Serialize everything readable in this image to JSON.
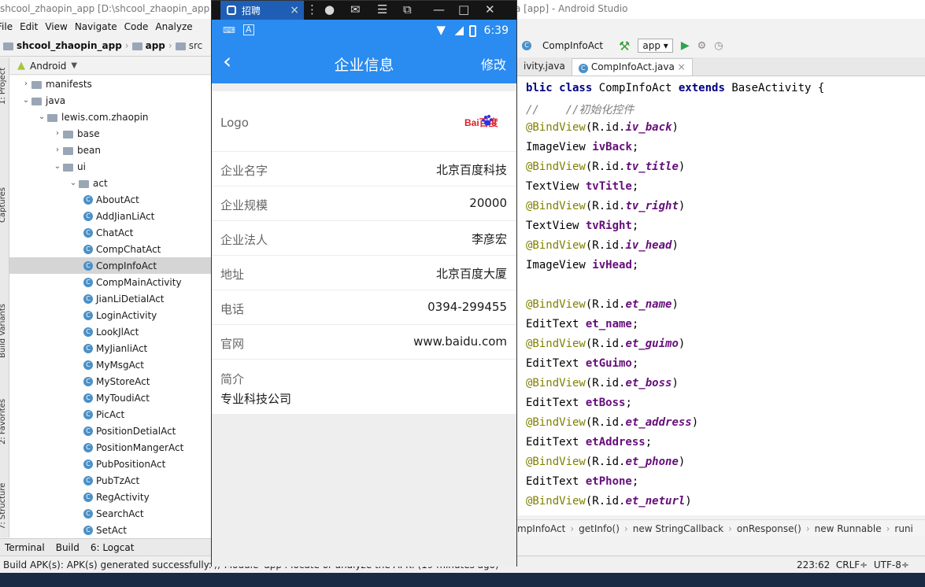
{
  "ide": {
    "title_left": "shcool_zhaopin_app [D:\\shcool_zhaopin_app",
    "title_right": "a [app] - Android Studio",
    "menu": [
      "File",
      "Edit",
      "View",
      "Navigate",
      "Code",
      "Analyze"
    ],
    "breadcrumb": [
      "shcool_zhaopin_app",
      "app",
      "src"
    ],
    "project_view": "Android",
    "tree": [
      {
        "label": "manifests",
        "indent": 1,
        "type": "folder",
        "arrow": "›"
      },
      {
        "label": "java",
        "indent": 1,
        "type": "folder",
        "arrow": "⌄"
      },
      {
        "label": "lewis.com.zhaopin",
        "indent": 2,
        "type": "folder",
        "arrow": "⌄"
      },
      {
        "label": "base",
        "indent": 3,
        "type": "folder",
        "arrow": "›"
      },
      {
        "label": "bean",
        "indent": 3,
        "type": "folder",
        "arrow": "›"
      },
      {
        "label": "ui",
        "indent": 3,
        "type": "folder",
        "arrow": "⌄"
      },
      {
        "label": "act",
        "indent": 4,
        "type": "folder",
        "arrow": "⌄"
      },
      {
        "label": "AboutAct",
        "indent": 5,
        "type": "class"
      },
      {
        "label": "AddJianLiAct",
        "indent": 5,
        "type": "class"
      },
      {
        "label": "ChatAct",
        "indent": 5,
        "type": "class"
      },
      {
        "label": "CompChatAct",
        "indent": 5,
        "type": "class"
      },
      {
        "label": "CompInfoAct",
        "indent": 5,
        "type": "class",
        "selected": true
      },
      {
        "label": "CompMainActivity",
        "indent": 5,
        "type": "class"
      },
      {
        "label": "JianLiDetialAct",
        "indent": 5,
        "type": "class"
      },
      {
        "label": "LoginActivity",
        "indent": 5,
        "type": "class"
      },
      {
        "label": "LookJlAct",
        "indent": 5,
        "type": "class"
      },
      {
        "label": "MyJianliAct",
        "indent": 5,
        "type": "class"
      },
      {
        "label": "MyMsgAct",
        "indent": 5,
        "type": "class"
      },
      {
        "label": "MyStoreAct",
        "indent": 5,
        "type": "class"
      },
      {
        "label": "MyToudiAct",
        "indent": 5,
        "type": "class"
      },
      {
        "label": "PicAct",
        "indent": 5,
        "type": "class"
      },
      {
        "label": "PositionDetialAct",
        "indent": 5,
        "type": "class"
      },
      {
        "label": "PositionMangerAct",
        "indent": 5,
        "type": "class"
      },
      {
        "label": "PubPositionAct",
        "indent": 5,
        "type": "class"
      },
      {
        "label": "PubTzAct",
        "indent": 5,
        "type": "class"
      },
      {
        "label": "RegActivity",
        "indent": 5,
        "type": "class"
      },
      {
        "label": "SearchAct",
        "indent": 5,
        "type": "class"
      },
      {
        "label": "SetAct",
        "indent": 5,
        "type": "class"
      }
    ],
    "side_tabs": [
      "1: Project",
      "Captures",
      "Build Variants",
      "2: Favorites",
      "7: Structure"
    ],
    "bottom_tabs": [
      "Terminal",
      "Build",
      "6: Logcat"
    ],
    "status_message": "Build APK(s): APK(s) generated successfully: // Module 'app': locate or analyze the APK. (19 minutes ago)",
    "status_position": "223:62",
    "status_crlf": "CRLF÷",
    "status_encoding": "UTF-8÷",
    "toolbar_crumb": "CompInfoAct",
    "run_config": "app",
    "editor_tabs": [
      "ivity.java",
      "CompInfoAct.java"
    ],
    "code_crumbs": [
      "mpInfoAct",
      "getInfo()",
      "new StringCallback",
      "onResponse()",
      "new Runnable",
      "runi"
    ]
  },
  "emulator": {
    "window_title": "招聘",
    "time": "6:39",
    "page_title": "企业信息",
    "back_symbol": "‹",
    "edit_label": "修改",
    "logo_label": "Logo",
    "fields": [
      {
        "label": "企业名字",
        "value": "北京百度科技"
      },
      {
        "label": "企业规模",
        "value": "20000"
      },
      {
        "label": "企业法人",
        "value": "李彦宏"
      },
      {
        "label": "地址",
        "value": "北京百度大厦"
      },
      {
        "label": "电话",
        "value": "0394-299455"
      },
      {
        "label": "官网",
        "value": "www.baidu.com"
      }
    ],
    "intro_label": "简介",
    "intro_value": "专业科技公司",
    "logo_text": "Bai百度"
  }
}
